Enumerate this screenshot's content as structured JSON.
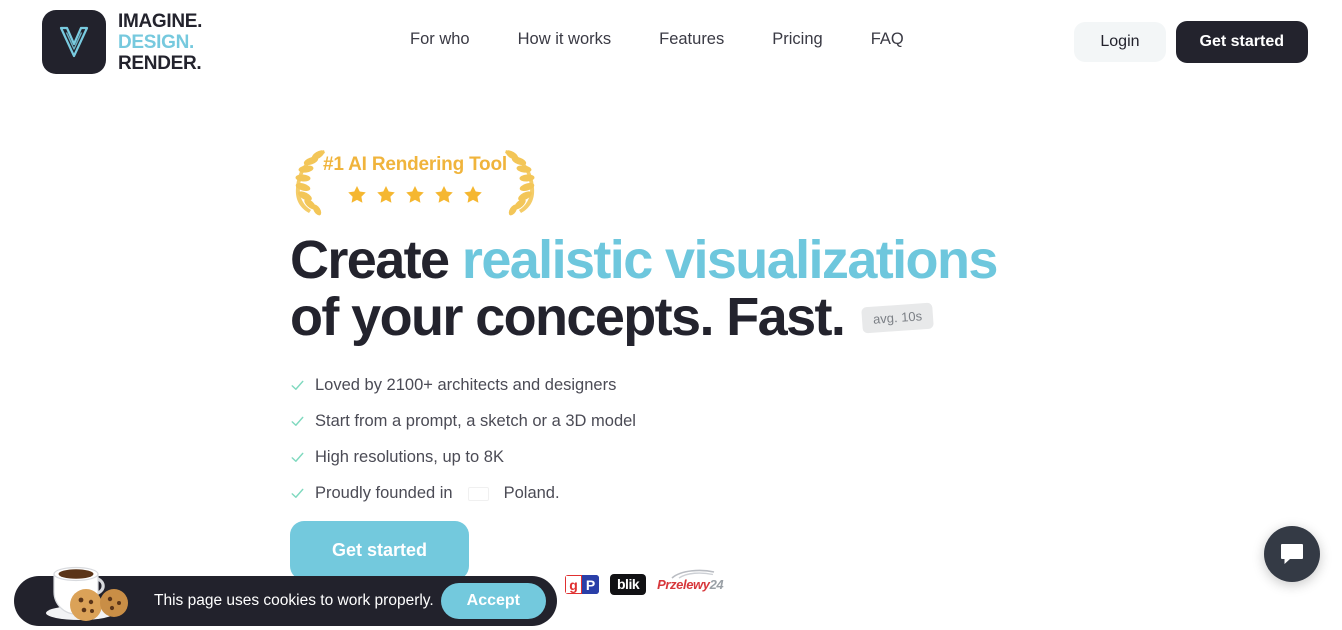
{
  "brand": {
    "logo_line1": "IMAGINE.",
    "logo_line2": "DESIGN.",
    "logo_line3": "RENDER.",
    "logo_icon": "v-monogram-icon",
    "accent_color": "#73c9dd",
    "dark_color": "#23232d"
  },
  "nav": {
    "items": [
      {
        "label": "For who"
      },
      {
        "label": "How it works"
      },
      {
        "label": "Features"
      },
      {
        "label": "Pricing"
      },
      {
        "label": "FAQ"
      }
    ],
    "login_label": "Login",
    "get_started_label": "Get started"
  },
  "hero": {
    "badge": {
      "text": "#1 AI Rendering Tool",
      "stars": 5,
      "star_color": "#f5b731",
      "text_color": "#f0b43c"
    },
    "headline_part1": "Create ",
    "headline_accent": "realistic visualizations",
    "headline_part2": "of your concepts. Fast.",
    "speed_badge": "avg. 10s",
    "features": [
      {
        "text": "Loved by 2100+ architects and designers"
      },
      {
        "text": "Start from a prompt, a sketch or a 3D model"
      },
      {
        "text": "High resolutions, up to 8K"
      }
    ],
    "feature_poland_prefix": "Proudly founded in",
    "feature_poland_suffix": "Poland.",
    "cta_label": "Get started"
  },
  "payments": {
    "google_pay_g": "g",
    "google_pay_p": "P",
    "blik": "blik",
    "przelewy_name": "Przelewy",
    "przelewy_number": "24"
  },
  "cookie": {
    "message": "This page uses cookies to work properly.",
    "accept_label": "Accept"
  },
  "chat": {
    "icon": "chat-bubble-icon"
  }
}
